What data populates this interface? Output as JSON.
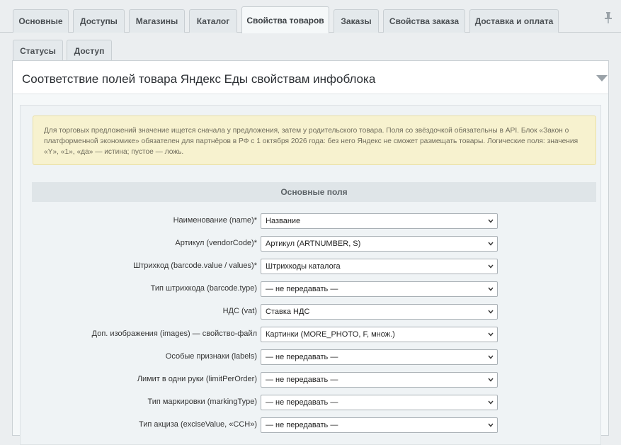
{
  "tabs": [
    {
      "label": "Основные",
      "active": false
    },
    {
      "label": "Доступы",
      "active": false
    },
    {
      "label": "Магазины",
      "active": false
    },
    {
      "label": "Каталог",
      "active": false
    },
    {
      "label": "Свойства товаров",
      "active": true
    },
    {
      "label": "Заказы",
      "active": false
    },
    {
      "label": "Свойства заказа",
      "active": false
    },
    {
      "label": "Доставка и оплата",
      "active": false
    }
  ],
  "subtabs": [
    {
      "label": "Статусы",
      "active": false
    },
    {
      "label": "Доступ",
      "active": false
    }
  ],
  "panel": {
    "title": "Соответствие полей товара Яндекс Еды свойствам инфоблока"
  },
  "notice": {
    "text": "Для торговых предложений значение ищется сначала у предложения, затем у родительского товара. Поля со звёздочкой обязательны в API. Блок «Закон о платформенной экономике» обязателен для партнёров в РФ с 1 октября 2026 года: без него Яндекс не сможет размещать товары. Логические поля: значения «Y», «1», «да» — истина; пустое — ложь."
  },
  "section": {
    "title": "Основные поля"
  },
  "fields": [
    {
      "label": "Наименование (name)*",
      "value": "Название"
    },
    {
      "label": "Артикул (vendorCode)*",
      "value": "Артикул (ARTNUMBER, S)"
    },
    {
      "label": "Штрихкод (barcode.value / values)*",
      "value": "Штрихкоды каталога"
    },
    {
      "label": "Тип штрихкода (barcode.type)",
      "value": "— не передавать —"
    },
    {
      "label": "НДС (vat)",
      "value": "Ставка НДС"
    },
    {
      "label": "Доп. изображения (images) — свойство-файл",
      "value": "Картинки (MORE_PHOTO, F, множ.)"
    },
    {
      "label": "Особые признаки (labels)",
      "value": "— не передавать —"
    },
    {
      "label": "Лимит в одни руки (limitPerOrder)",
      "value": "— не передавать —"
    },
    {
      "label": "Тип маркировки (markingType)",
      "value": "— не передавать —"
    },
    {
      "label": "Тип акциза (exciseValue, «ССН»)",
      "value": "— не передавать —"
    }
  ]
}
